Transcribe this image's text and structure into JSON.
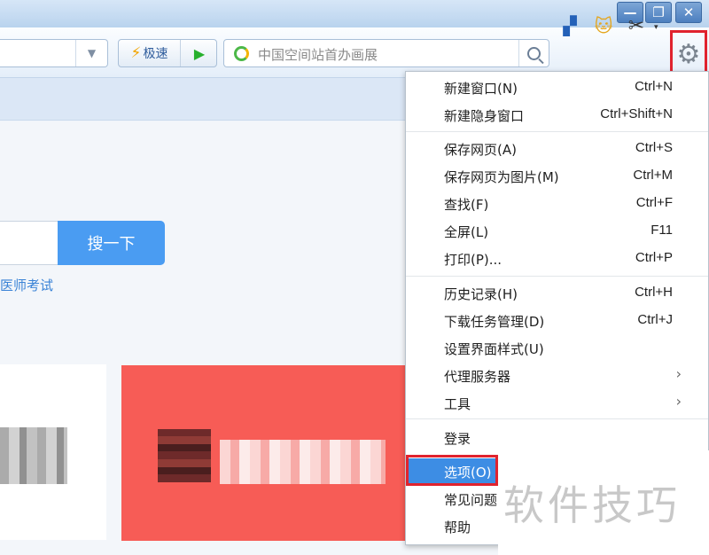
{
  "window": {
    "minimize_glyph": "—",
    "restore_glyph": "❐",
    "close_glyph": "✕"
  },
  "toolbar": {
    "address_dropdown_glyph": "▼",
    "mode_fast_label": "极速",
    "bolt_glyph": "⚡",
    "play_glyph": "▶",
    "search_placeholder": "中国空间站首办画展",
    "icons": [
      "apps-plus-icon",
      "cat-icon",
      "scissors-icon",
      "settings-gear-icon"
    ],
    "apps_glyph": "▞",
    "cat_glyph": "🐱",
    "scissors_glyph": "✂",
    "scissors_dropdown_glyph": "▾",
    "gear_glyph": "⚙"
  },
  "page": {
    "search_button_label": "搜一下",
    "search_link_text": "医师考试"
  },
  "menu": {
    "items": [
      {
        "label": "新建窗口(N)",
        "shortcut": "Ctrl+N"
      },
      {
        "label": "新建隐身窗口",
        "shortcut": "Ctrl+Shift+N"
      },
      {
        "label": "保存网页(A)",
        "shortcut": "Ctrl+S"
      },
      {
        "label": "保存网页为图片(M)",
        "shortcut": "Ctrl+M"
      },
      {
        "label": "查找(F)",
        "shortcut": "Ctrl+F"
      },
      {
        "label": "全屏(L)",
        "shortcut": "F11"
      },
      {
        "label": "打印(P)...",
        "shortcut": "Ctrl+P"
      },
      {
        "label": "历史记录(H)",
        "shortcut": "Ctrl+H"
      },
      {
        "label": "下载任务管理(D)",
        "shortcut": "Ctrl+J"
      },
      {
        "label": "设置界面样式(U)",
        "shortcut": ""
      },
      {
        "label": "代理服务器",
        "shortcut": "",
        "arrow": "›"
      },
      {
        "label": "工具",
        "shortcut": "",
        "arrow": "›"
      },
      {
        "label": "登录",
        "shortcut": ""
      },
      {
        "label": "选项(O)",
        "shortcut": "",
        "selected": true
      },
      {
        "label": "常见问题",
        "shortcut": ""
      },
      {
        "label": "帮助",
        "shortcut": ""
      }
    ]
  },
  "watermark": {
    "text": "软件技巧"
  },
  "colors": {
    "accent": "#3d8de4",
    "highlight_frame": "#e0232e",
    "card_red": "#f75c56",
    "search_button": "#4a9cf2"
  }
}
